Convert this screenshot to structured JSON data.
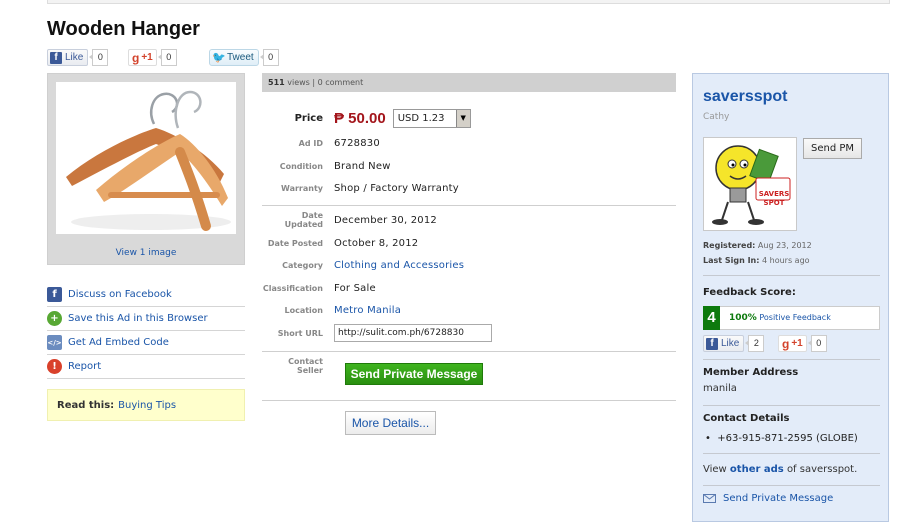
{
  "page": {
    "title": "Wooden Hanger"
  },
  "social": {
    "like_label": "Like",
    "like_count": "0",
    "gplus_label": "+1",
    "gplus_count": "0",
    "tweet_label": "Tweet",
    "tweet_count": "0"
  },
  "image_panel": {
    "view_label": "View 1 image"
  },
  "actions": [
    {
      "label": "Discuss on Facebook",
      "icon": "facebook-icon"
    },
    {
      "label": "Save this Ad in this Browser",
      "icon": "add-icon"
    },
    {
      "label": "Get Ad Embed Code",
      "icon": "embed-icon"
    },
    {
      "label": "Report",
      "icon": "warning-icon"
    }
  ],
  "read_this": {
    "prefix": "Read this:",
    "link": "Buying Tips"
  },
  "stats": {
    "views": "511",
    "views_label": "views",
    "comments": "0 comment"
  },
  "details": {
    "price_label": "Price",
    "price": "₱ 50.00",
    "currency_select": "USD 1.23",
    "ad_id_label": "Ad ID",
    "ad_id": "6728830",
    "condition_label": "Condition",
    "condition": "Brand New",
    "warranty_label": "Warranty",
    "warranty": "Shop / Factory Warranty",
    "date_updated_label": "Date Updated",
    "date_updated": "December 30, 2012",
    "date_posted_label": "Date Posted",
    "date_posted": "October 8, 2012",
    "category_label": "Category",
    "category": "Clothing and Accessories",
    "classification_label": "Classification",
    "classification": "For Sale",
    "location_label": "Location",
    "location": "Metro Manila",
    "short_url_label": "Short URL",
    "short_url": "http://sulit.com.ph/6728830",
    "contact_label": "Contact Seller",
    "send_private_message": "Send Private Message",
    "more_details": "More Details..."
  },
  "seller": {
    "name": "saversspot",
    "username": "Cathy",
    "send_pm": "Send PM",
    "avatar_text": "SAVERS SPOT",
    "registered_label": "Registered:",
    "registered": "Aug 23, 2012",
    "last_signin_label": "Last Sign In:",
    "last_signin": "4 hours ago",
    "feedback_label": "Feedback Score:",
    "feedback_score": "4",
    "feedback_percent": "100%",
    "feedback_text": "Positive Feedback",
    "like_label": "Like",
    "like_count": "2",
    "gplus_label": "+1",
    "gplus_count": "0",
    "address_label": "Member Address",
    "address": "manila",
    "contact_label": "Contact Details",
    "phone": "+63-915-871-2595 (GLOBE)",
    "view_prefix": "View",
    "view_link": "other ads",
    "view_suffix": "of saversspot.",
    "send_private_message": "Send Private Message"
  },
  "colors": {
    "price": "#a3151b",
    "link": "#1a55a8",
    "send_button": "#2a8f10",
    "seller_panel": "#e3ecf9",
    "feedback_green": "#0d7a0d"
  }
}
